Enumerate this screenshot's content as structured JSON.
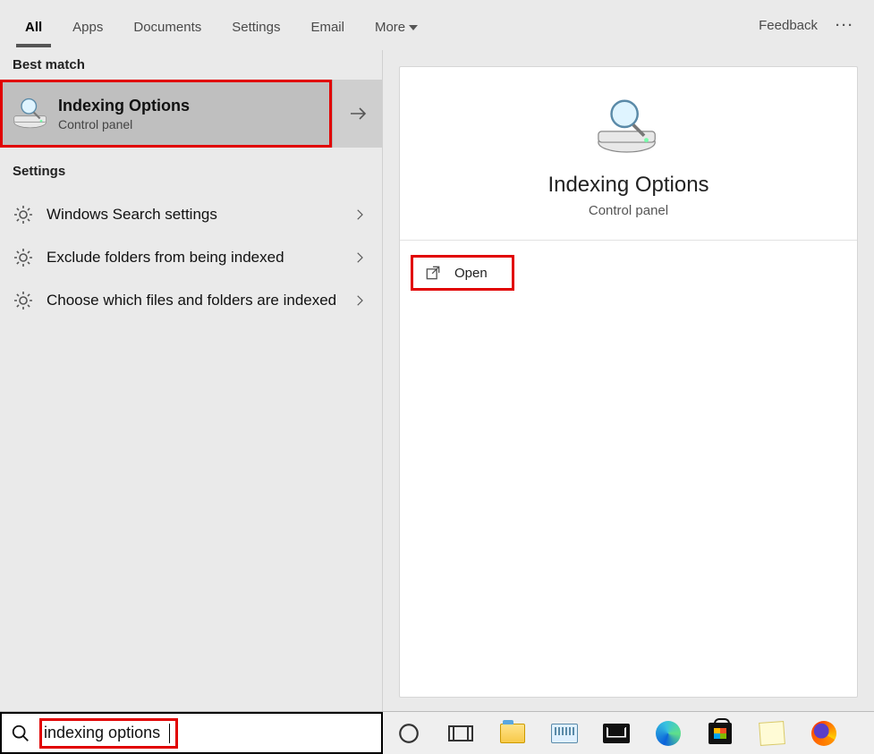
{
  "tabs": {
    "items": [
      "All",
      "Apps",
      "Documents",
      "Settings",
      "Email",
      "More"
    ],
    "active_index": 0,
    "feedback_label": "Feedback"
  },
  "left": {
    "best_match_header": "Best match",
    "best_match": {
      "title": "Indexing Options",
      "subtitle": "Control panel"
    },
    "settings_header": "Settings",
    "settings_items": [
      {
        "label": "Windows Search settings"
      },
      {
        "label": "Exclude folders from being indexed"
      },
      {
        "label": "Choose which files and folders are indexed"
      }
    ]
  },
  "right": {
    "title": "Indexing Options",
    "subtitle": "Control panel",
    "actions": [
      {
        "label": "Open"
      }
    ]
  },
  "search": {
    "value": "indexing options"
  },
  "taskbar_icons": [
    "cortana",
    "task-view",
    "file-explorer",
    "on-screen-keyboard",
    "mail",
    "edge",
    "microsoft-store",
    "sticky-notes",
    "firefox"
  ]
}
